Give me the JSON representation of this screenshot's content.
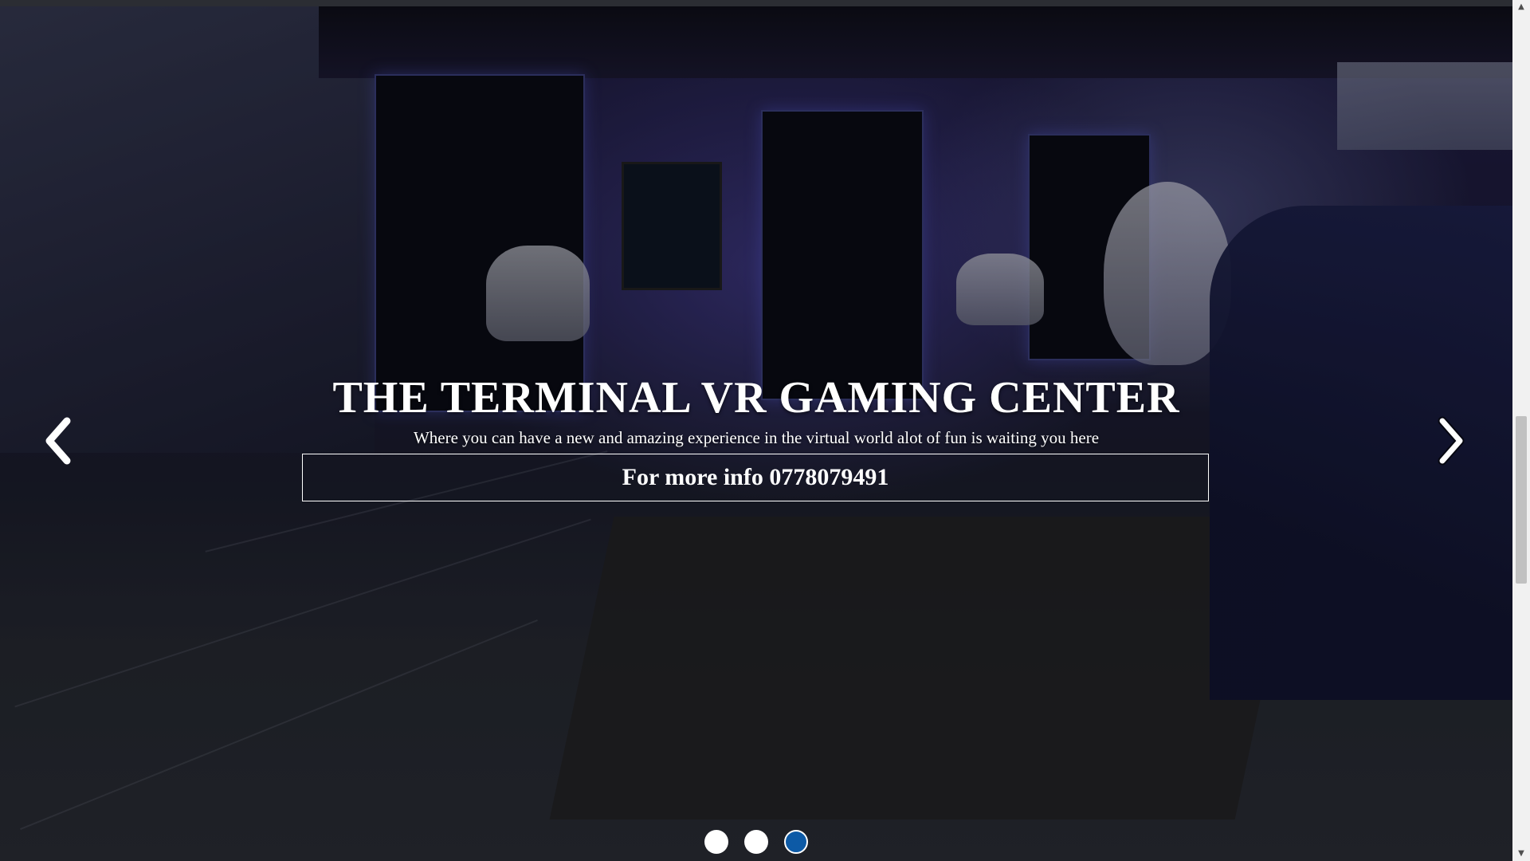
{
  "hero": {
    "title": "THE TERMINAL VR GAMING CENTER",
    "subtitle": "Where you can have a new and amazing experience in the virtual world alot of fun is waiting you here",
    "info_button_label": "For more info 0778079491"
  },
  "carousel": {
    "prev_icon": "chevron-left-icon",
    "next_icon": "chevron-right-icon",
    "slide_count": 3,
    "active_index": 3,
    "indicator_active_color": "#0d5aa6",
    "indicator_color": "#ffffff"
  },
  "scrollbar": {
    "up_glyph": "▲",
    "down_glyph": "▼"
  }
}
